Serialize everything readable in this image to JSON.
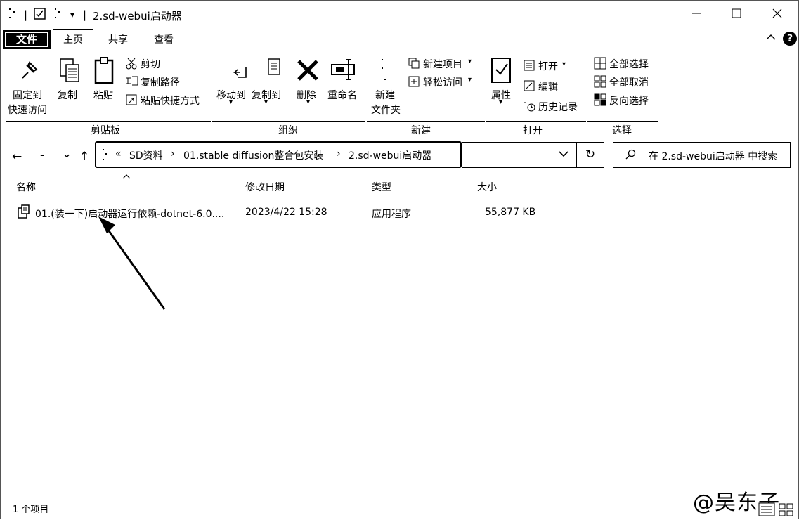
{
  "window": {
    "title": "2.sd-webui启动器",
    "minimize": "─",
    "maximize": "☐",
    "close": "✕"
  },
  "quick_access": {
    "dropdown": "▾",
    "separator": "|"
  },
  "tabs": {
    "file": "文件",
    "home": "主页",
    "share": "共享",
    "view": "查看",
    "help": "?"
  },
  "ribbon": {
    "clipboard": {
      "label": "剪贴板",
      "pin_label_1": "固定到",
      "pin_label_2": "快速访问",
      "copy": "复制",
      "paste": "粘贴",
      "cut": "剪切",
      "copy_path": "复制路径",
      "paste_shortcut": "粘贴快捷方式"
    },
    "organize": {
      "label": "组织",
      "move_to": "移动到",
      "copy_to": "复制到",
      "delete": "删除",
      "rename": "重命名"
    },
    "new": {
      "label": "新建",
      "new_folder_1": "新建",
      "new_folder_2": "文件夹",
      "new_item": "新建项目",
      "easy_access": "轻松访问"
    },
    "open": {
      "label": "打开",
      "properties": "属性",
      "open": "打开",
      "edit": "编辑",
      "history": "历史记录"
    },
    "select": {
      "label": "选择",
      "select_all": "全部选择",
      "select_none": "全部取消",
      "invert": "反向选择"
    }
  },
  "nav": {
    "back": "←",
    "forward": "→",
    "recent": "⌄",
    "up": "↑"
  },
  "address": {
    "overflow": "«",
    "crumbs": [
      "SD资料",
      "01.stable diffusion整合包安装",
      "2.sd-webui启动器"
    ],
    "sep": "›",
    "dropdown": "⌄",
    "refresh": "↻"
  },
  "search": {
    "placeholder": "在 2.sd-webui启动器 中搜索",
    "icon": "⌕"
  },
  "columns": {
    "name": "名称",
    "modified": "修改日期",
    "type": "类型",
    "size": "大小",
    "sort_indicator": "^"
  },
  "files": [
    {
      "name": "01.(装一下)启动器运行依赖-dotnet-6.0....",
      "modified": "2023/4/22 15:28",
      "type": "应用程序",
      "size": "55,877 KB"
    }
  ],
  "status": {
    "count": "1 个项目"
  },
  "watermark": "@吴东子"
}
